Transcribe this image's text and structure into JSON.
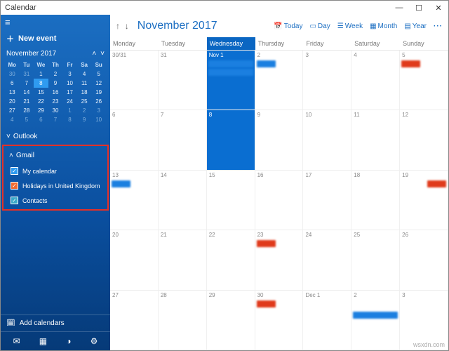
{
  "window": {
    "title": "Calendar",
    "min": "—",
    "max": "☐",
    "close": "✕"
  },
  "sidebar": {
    "new_event": "New event",
    "month_label": "November 2017",
    "dow": [
      "Mo",
      "Tu",
      "We",
      "Th",
      "Fr",
      "Sa",
      "Su"
    ],
    "outlook": "Outlook",
    "gmail": "Gmail",
    "cal_items": [
      {
        "label": "My calendar"
      },
      {
        "label": "Holidays in United Kingdom"
      },
      {
        "label": "Contacts"
      }
    ],
    "add_cal": "Add calendars"
  },
  "toolbar": {
    "title": "November 2017",
    "today": "Today",
    "day": "Day",
    "week": "Week",
    "month": "Month",
    "year": "Year"
  },
  "days": [
    "Monday",
    "Tuesday",
    "Wednesday",
    "Thursday",
    "Friday",
    "Saturday",
    "Sunday"
  ],
  "watermark": "wsxdn.com",
  "mini_weeks": [
    [
      "30",
      "31",
      "1",
      "2",
      "3",
      "4",
      "5"
    ],
    [
      "6",
      "7",
      "8",
      "9",
      "10",
      "11",
      "12"
    ],
    [
      "13",
      "14",
      "15",
      "16",
      "17",
      "18",
      "19"
    ],
    [
      "20",
      "21",
      "22",
      "23",
      "24",
      "25",
      "26"
    ],
    [
      "27",
      "28",
      "29",
      "30",
      "1",
      "2",
      "3"
    ],
    [
      "4",
      "5",
      "6",
      "7",
      "8",
      "9",
      "10"
    ]
  ],
  "grid_weeks": [
    [
      "30/31",
      "31",
      "Nov 1",
      "2",
      "3",
      "4",
      "5"
    ],
    [
      "6",
      "7",
      "8",
      "9",
      "10",
      "11",
      "12"
    ],
    [
      "13",
      "14",
      "15",
      "16",
      "17",
      "18",
      "19"
    ],
    [
      "20",
      "21",
      "22",
      "23",
      "24",
      "25",
      "26"
    ],
    [
      "27",
      "28",
      "29",
      "30",
      "Dec 1",
      "2",
      "3"
    ]
  ]
}
